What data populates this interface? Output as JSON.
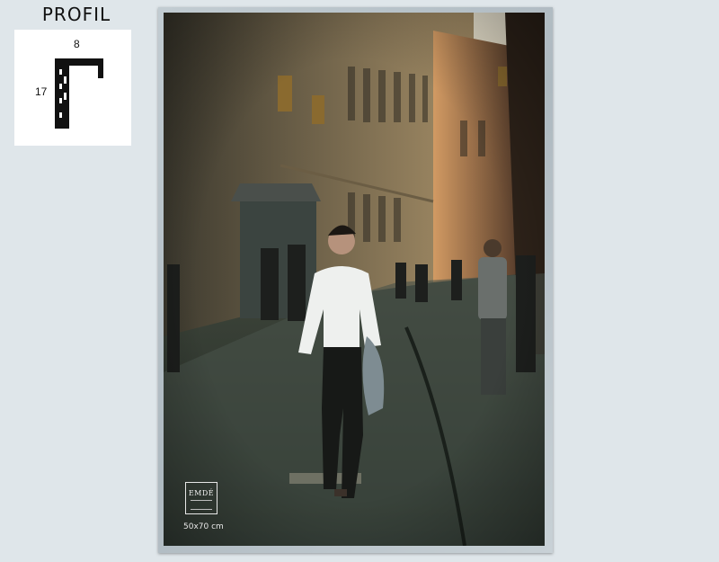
{
  "profile": {
    "title": "PROFIL",
    "width": "8",
    "height": "17"
  },
  "poster": {
    "brand": "EMDÉ",
    "size": "50x70 cm"
  }
}
